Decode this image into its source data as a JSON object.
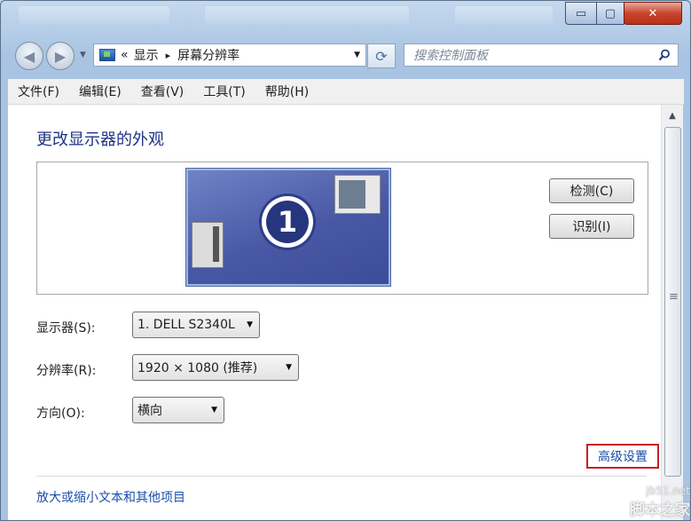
{
  "window": {
    "title_buttons": {
      "minimize": "▭",
      "maximize": "▢",
      "close": "✕"
    }
  },
  "nav": {
    "address": {
      "chevron": "«",
      "segments": [
        "显示",
        "屏幕分辨率"
      ],
      "separator": "▸"
    },
    "search_placeholder": "搜索控制面板"
  },
  "menubar": {
    "items": [
      "文件(F)",
      "编辑(E)",
      "查看(V)",
      "工具(T)",
      "帮助(H)"
    ]
  },
  "main": {
    "heading": "更改显示器的外观",
    "monitor_number": "1",
    "detect_button": "检测(C)",
    "identify_button": "识别(I)",
    "display": {
      "label": "显示器(S):",
      "value": "1. DELL S2340L"
    },
    "resolution": {
      "label": "分辨率(R):",
      "value": "1920 × 1080 (推荐)"
    },
    "orientation": {
      "label": "方向(O):",
      "value": "横向"
    },
    "advanced_link": "高级设置",
    "bottom_link": "放大或缩小文本和其他项目"
  },
  "watermark": {
    "site": "jb51.net",
    "name": "脚本之家"
  },
  "colors": {
    "accent_link": "#1a4ea8",
    "highlight_box": "#c81e28",
    "heading": "#1e3287"
  }
}
